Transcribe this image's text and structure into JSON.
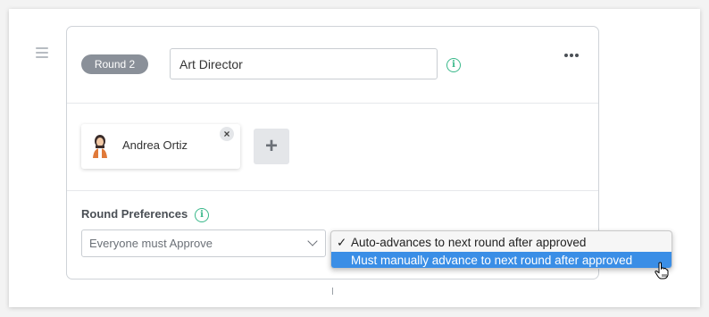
{
  "round": {
    "badge_label": "Round 2",
    "name_value": "Art Director"
  },
  "members": [
    {
      "name": "Andrea Ortiz"
    }
  ],
  "preferences": {
    "label": "Round Preferences",
    "selected": "Everyone must Approve"
  },
  "dropdown": {
    "options": [
      {
        "label": "Auto-advances to next round after approved",
        "checked": true,
        "highlighted": false
      },
      {
        "label": "Must manually advance to next round after approved",
        "checked": false,
        "highlighted": true
      }
    ],
    "check_glyph": "✓"
  },
  "icons": {
    "drag": "drag-handle-icon",
    "info": "info-icon",
    "more": "more-horizontal-icon",
    "remove": "close-icon",
    "add": "plus-icon",
    "chevron": "chevron-down-icon",
    "cursor": "hand-pointer-icon"
  },
  "colors": {
    "badge": "#8a9099",
    "info": "#39b88a",
    "highlight": "#3a8ee6"
  }
}
